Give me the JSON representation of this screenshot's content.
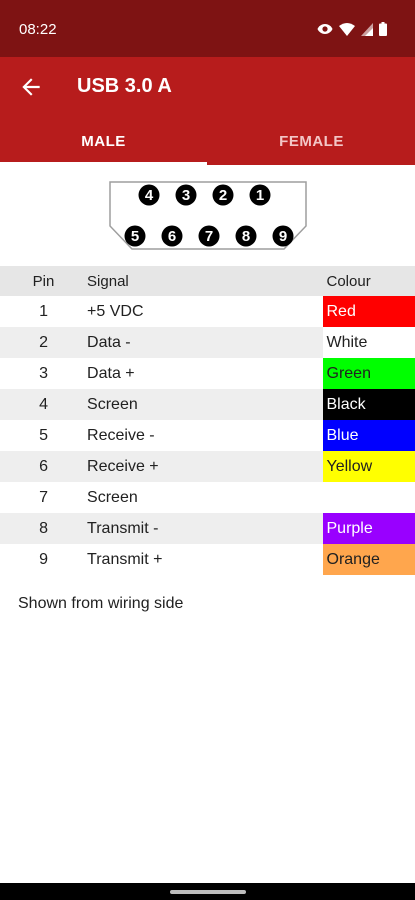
{
  "status_bar": {
    "time": "08:22",
    "icons": [
      "eye-icon",
      "wifi-icon",
      "signal-icon",
      "battery-icon"
    ]
  },
  "app_bar": {
    "title": "USB 3.0 A",
    "back_icon": "arrow-left-icon"
  },
  "tabs": {
    "male": "MALE",
    "female": "FEMALE",
    "selected": "MALE"
  },
  "connector": {
    "top_pins": [
      "4",
      "3",
      "2",
      "1"
    ],
    "bottom_pins": [
      "5",
      "6",
      "7",
      "8",
      "9"
    ]
  },
  "table": {
    "headers": {
      "pin": "Pin",
      "signal": "Signal",
      "colour": "Colour"
    },
    "rows": [
      {
        "pin": "1",
        "signal": "+5 VDC",
        "colour": "Red",
        "bg": "#ff0000",
        "fg": "#ffffff"
      },
      {
        "pin": "2",
        "signal": "Data -",
        "colour": "White",
        "bg": "#ffffff",
        "fg": "#212121"
      },
      {
        "pin": "3",
        "signal": "Data +",
        "colour": "Green",
        "bg": "#00ff00",
        "fg": "#212121"
      },
      {
        "pin": "4",
        "signal": "Screen",
        "colour": "Black",
        "bg": "#000000",
        "fg": "#ffffff"
      },
      {
        "pin": "5",
        "signal": "Receive -",
        "colour": "Blue",
        "bg": "#0000ff",
        "fg": "#ffffff"
      },
      {
        "pin": "6",
        "signal": "Receive +",
        "colour": "Yellow",
        "bg": "#ffff00",
        "fg": "#212121"
      },
      {
        "pin": "7",
        "signal": "Screen",
        "colour": "",
        "bg": "",
        "fg": "#212121"
      },
      {
        "pin": "8",
        "signal": "Transmit -",
        "colour": "Purple",
        "bg": "#9900ff",
        "fg": "#ffffff"
      },
      {
        "pin": "9",
        "signal": "Transmit +",
        "colour": "Orange",
        "bg": "#ffa64d",
        "fg": "#212121"
      }
    ]
  },
  "note": "Shown from wiring side",
  "theme": {
    "status_bar": "#7e1313",
    "primary": "#b71c1c"
  }
}
